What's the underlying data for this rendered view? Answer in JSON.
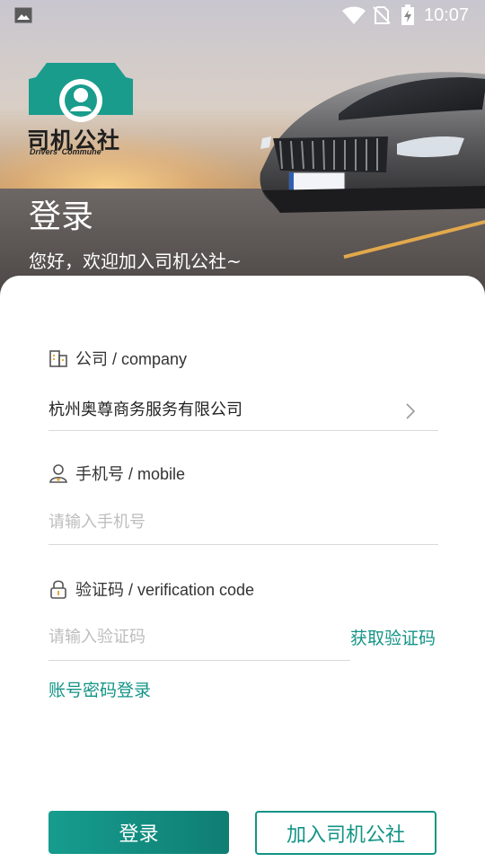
{
  "status_bar": {
    "time": "10:07",
    "icons": [
      "gallery-icon",
      "wifi-icon",
      "no-sim-icon",
      "battery-charging-icon"
    ]
  },
  "brand": {
    "name": "司机公社",
    "tagline": "Drivers' Commune",
    "color": "#1a9c8c"
  },
  "hero": {
    "title": "登录",
    "subtitle": "您好，欢迎加入司机公社~"
  },
  "form": {
    "company": {
      "label": "公司 / company",
      "value": "杭州奥尊商务服务有限公司",
      "icon": "building-icon"
    },
    "mobile": {
      "label": "手机号 / mobile",
      "placeholder": "请输入手机号",
      "value": "",
      "icon": "user-icon"
    },
    "code": {
      "label": "验证码 / verification code",
      "placeholder": "请输入验证码",
      "value": "",
      "icon": "lock-icon",
      "get_code_label": "获取验证码"
    },
    "account_login_label": "账号密码登录"
  },
  "actions": {
    "login_label": "登录",
    "join_label": "加入司机公社"
  },
  "colors": {
    "accent": "#139486",
    "placeholder": "#bdbdbd",
    "divider": "#d9d9d9"
  }
}
